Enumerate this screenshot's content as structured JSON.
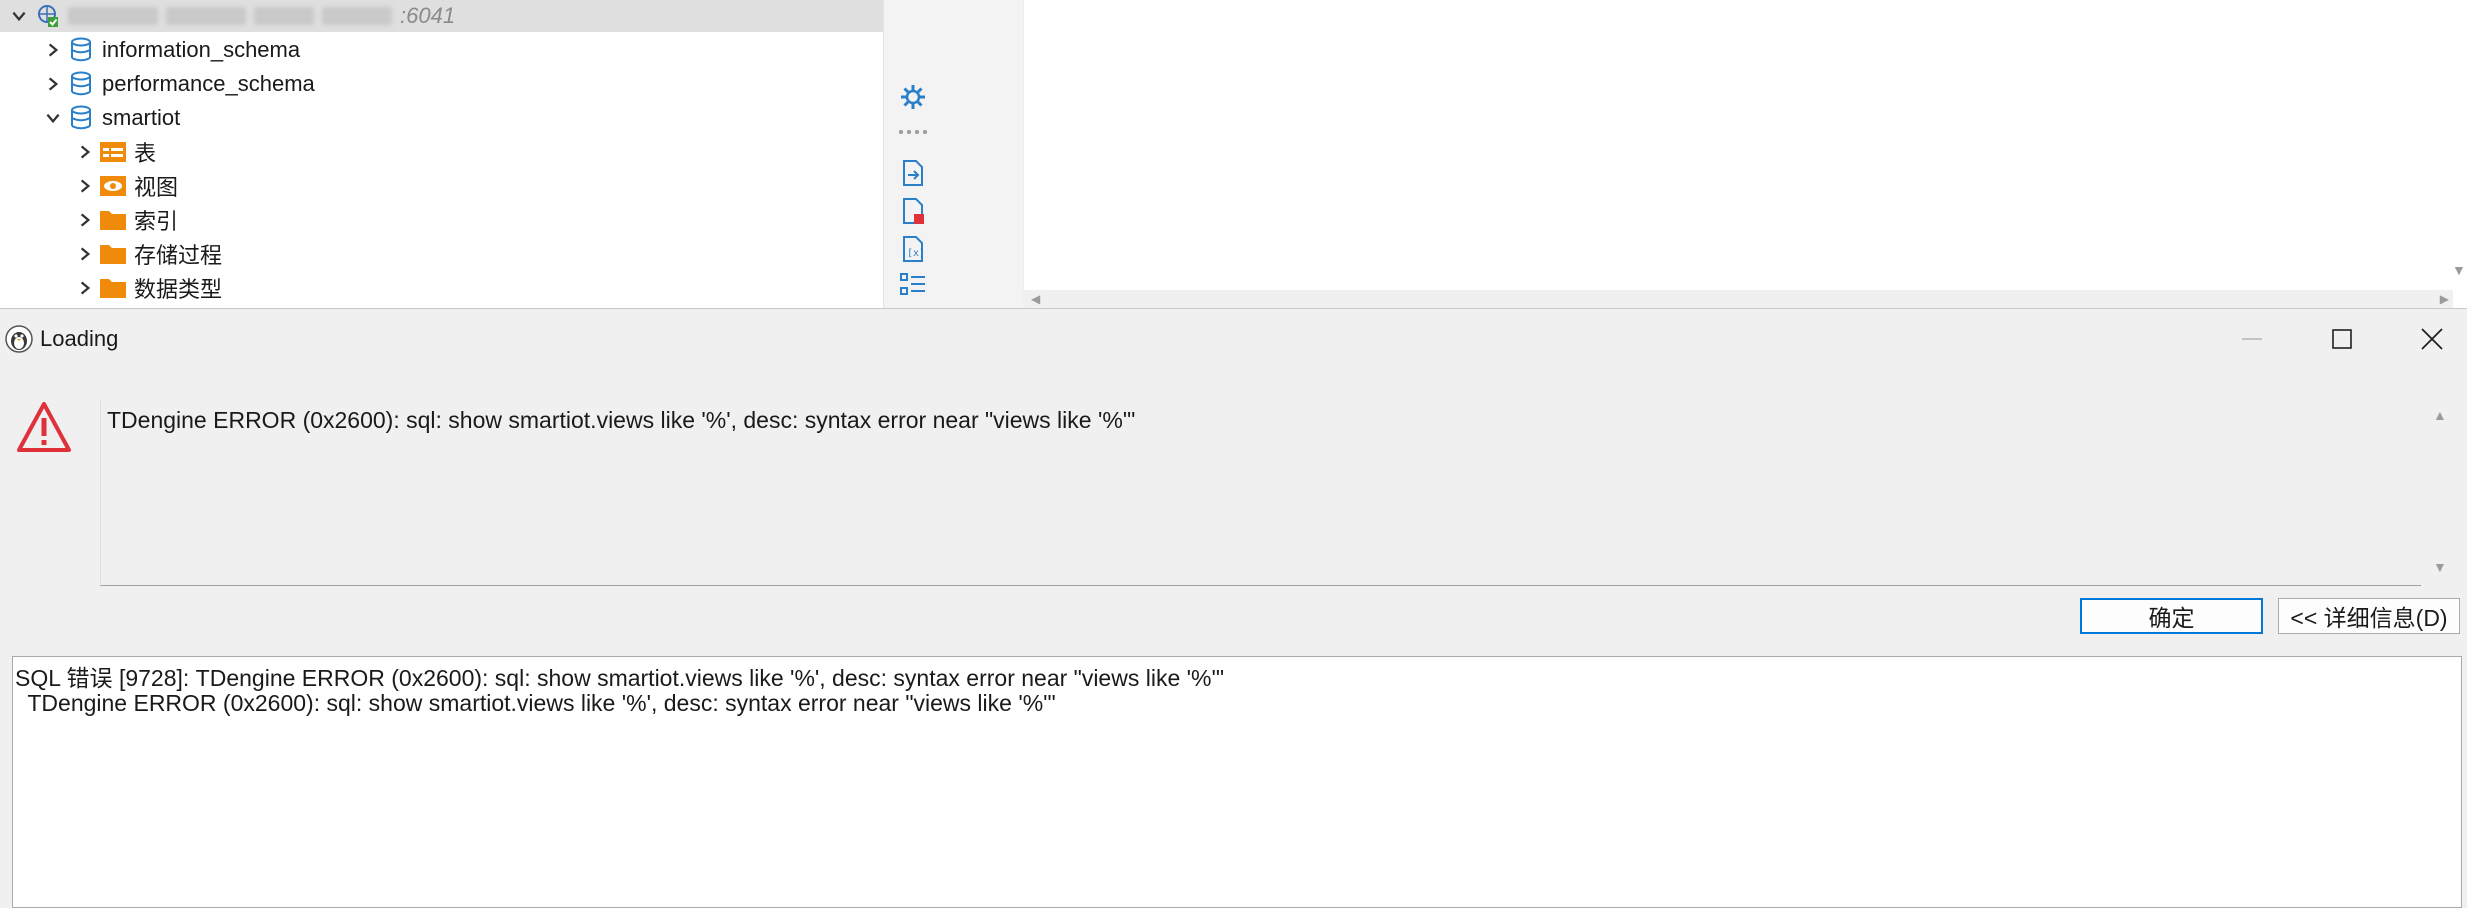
{
  "navigator": {
    "connection_label_suffix": ":6041",
    "databases": [
      {
        "label": "information_schema",
        "expanded": false
      },
      {
        "label": "performance_schema",
        "expanded": false
      },
      {
        "label": "smartiot",
        "expanded": true
      }
    ],
    "smartiot_children": [
      {
        "label": "表",
        "icon": "table-icon"
      },
      {
        "label": "视图",
        "icon": "view-icon"
      },
      {
        "label": "索引",
        "icon": "folder-icon"
      },
      {
        "label": "存储过程",
        "icon": "folder-icon"
      },
      {
        "label": "数据类型",
        "icon": "folder-icon"
      }
    ]
  },
  "side_toolbar": {
    "icons": [
      "gear-icon",
      "more-dots-icon",
      "import-icon",
      "file-error-icon",
      "variables-icon",
      "outline-icon"
    ]
  },
  "dialog": {
    "title": "Loading",
    "message": "TDengine ERROR (0x2600): sql: show smartiot.views like '%', desc: syntax error near \"views like '%'\"",
    "ok_label": "确定",
    "details_label": "<< 详细信息(D)",
    "details_lines": [
      "SQL 错误 [9728]: TDengine ERROR (0x2600): sql: show smartiot.views like '%', desc: syntax error near \"views like '%'\"",
      "  TDengine ERROR (0x2600): sql: show smartiot.views like '%', desc: syntax error near \"views like '%'\""
    ]
  },
  "colors": {
    "db_icon": "#2a7fc9",
    "folder": "#f08a0a",
    "warning": "#e0303a",
    "accent": "#0078d7"
  }
}
